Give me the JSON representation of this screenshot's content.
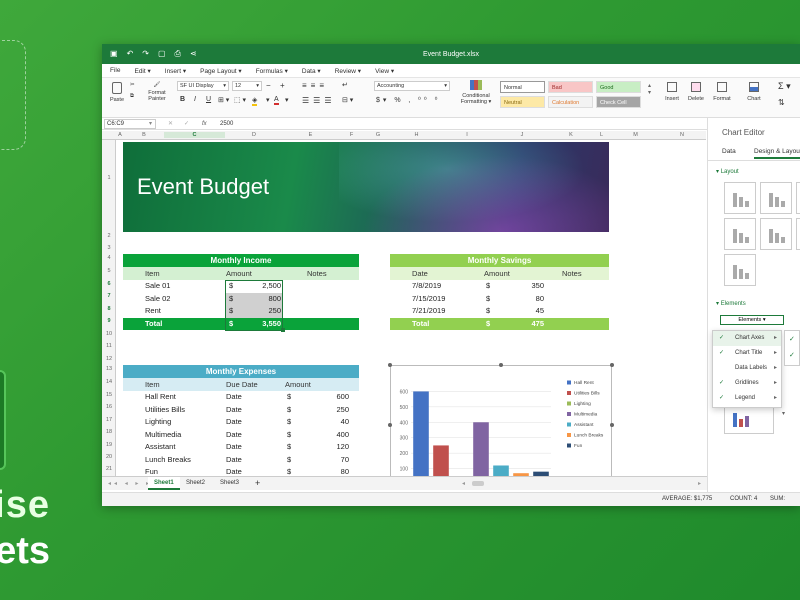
{
  "app": {
    "title": "Event Budget.xlsx"
  },
  "menu": [
    "File",
    "Edit",
    "Insert",
    "Page Layout",
    "Formulas",
    "Data",
    "Review",
    "View"
  ],
  "ribbon": {
    "paste": "Paste",
    "format_painter_1": "Format",
    "format_painter_2": "Painter",
    "font_name": "SF UI Display",
    "font_size": "12",
    "number_format": "Accounting",
    "cond_fmt_1": "Conditional",
    "cond_fmt_2": "Formatting",
    "styles": [
      {
        "label": "Normal",
        "bg": "#ffffff",
        "fg": "#333333"
      },
      {
        "label": "Bad",
        "bg": "#f8c6c6",
        "fg": "#9c2525"
      },
      {
        "label": "Good",
        "bg": "#c8eec4",
        "fg": "#1d6b1d"
      },
      {
        "label": "Neutral",
        "bg": "#fde9a6",
        "fg": "#8a6a10"
      },
      {
        "label": "Calculation",
        "bg": "#f3f3f3",
        "fg": "#e07a30"
      },
      {
        "label": "Check Cell",
        "bg": "#a5a5a5",
        "fg": "#ffffff"
      }
    ],
    "insert": "Insert",
    "delete": "Delete",
    "format": "Format",
    "chart": "Chart"
  },
  "formula_bar": {
    "name_box": "C6:C9",
    "fx": "fx",
    "value": "2500"
  },
  "columns": [
    "A",
    "B",
    "C",
    "D",
    "E",
    "F",
    "G",
    "H",
    "I",
    "J",
    "K",
    "L",
    "M",
    "N"
  ],
  "rows": [
    "1",
    "2",
    "3",
    "4",
    "5",
    "6",
    "7",
    "8",
    "9",
    "10",
    "11",
    "12",
    "13",
    "14",
    "15",
    "16",
    "17",
    "18",
    "19",
    "20",
    "21",
    "22"
  ],
  "banner_title": "Event Budget",
  "income": {
    "title": "Monthly Income",
    "headers": [
      "Item",
      "Amount",
      "Notes"
    ],
    "rows": [
      [
        "Sale 01",
        "$",
        "2,500"
      ],
      [
        "Sale 02",
        "$",
        "800"
      ],
      [
        "Rent",
        "$",
        "250"
      ]
    ],
    "total": [
      "Total",
      "$",
      "3,550"
    ]
  },
  "savings": {
    "title": "Monthly Savings",
    "headers": [
      "Date",
      "Amount",
      "Notes"
    ],
    "rows": [
      [
        "7/8/2019",
        "$",
        "350"
      ],
      [
        "7/15/2019",
        "$",
        "80"
      ],
      [
        "7/21/2019",
        "$",
        "45"
      ]
    ],
    "total": [
      "Total",
      "$",
      "475"
    ]
  },
  "expenses": {
    "title": "Monthly Expenses",
    "headers": [
      "Item",
      "Due Date",
      "Amount"
    ],
    "rows": [
      [
        "Hall Rent",
        "Date",
        "$",
        "600"
      ],
      [
        "Utilities Bills",
        "Date",
        "$",
        "250"
      ],
      [
        "Lighting",
        "Date",
        "$",
        "40"
      ],
      [
        "Multimedia",
        "Date",
        "$",
        "400"
      ],
      [
        "Assistant",
        "Date",
        "$",
        "120"
      ],
      [
        "Lunch Breaks",
        "Date",
        "$",
        "70"
      ],
      [
        "Fun",
        "Date",
        "$",
        "80"
      ]
    ]
  },
  "chart_data": {
    "type": "bar",
    "categories": [
      "Hall Rent",
      "Utilities Bills",
      "Lighting",
      "Multimedia",
      "Assistant",
      "Lunch Breaks",
      "Fun"
    ],
    "values": [
      600,
      250,
      40,
      400,
      120,
      70,
      80
    ],
    "colors": [
      "#4472c4",
      "#c0504d",
      "#9bbb59",
      "#8064a2",
      "#4bacc6",
      "#f79646",
      "#2c4d75"
    ],
    "yticks": [
      0,
      100,
      200,
      300,
      400,
      500,
      600
    ],
    "ylim": [
      0,
      700
    ],
    "legend": "right"
  },
  "sheets": [
    "Sheet1",
    "Sheet2",
    "Sheet3"
  ],
  "status": {
    "average": "AVERAGE: $1,775",
    "count": "COUNT: 4",
    "sum": "SUM:"
  },
  "panel": {
    "title": "Chart Editor",
    "tabs": [
      "Data",
      "Design & Layout"
    ],
    "layout_label": "Layout",
    "elements_label": "Elements",
    "elements_select": "Elements"
  },
  "dropdown": [
    {
      "label": "Chart Axes",
      "checked": true,
      "arrow": true
    },
    {
      "label": "Chart Title",
      "checked": true,
      "arrow": true
    },
    {
      "label": "Data Labels",
      "checked": false,
      "arrow": true
    },
    {
      "label": "Gridlines",
      "checked": true,
      "arrow": true
    },
    {
      "label": "Legend",
      "checked": true,
      "arrow": true
    }
  ],
  "colors": {
    "green_dark": "#1d7a3a",
    "income_green": "#0aa33a",
    "savings_green": "#92d050",
    "expenses_blue": "#4bacc6"
  }
}
